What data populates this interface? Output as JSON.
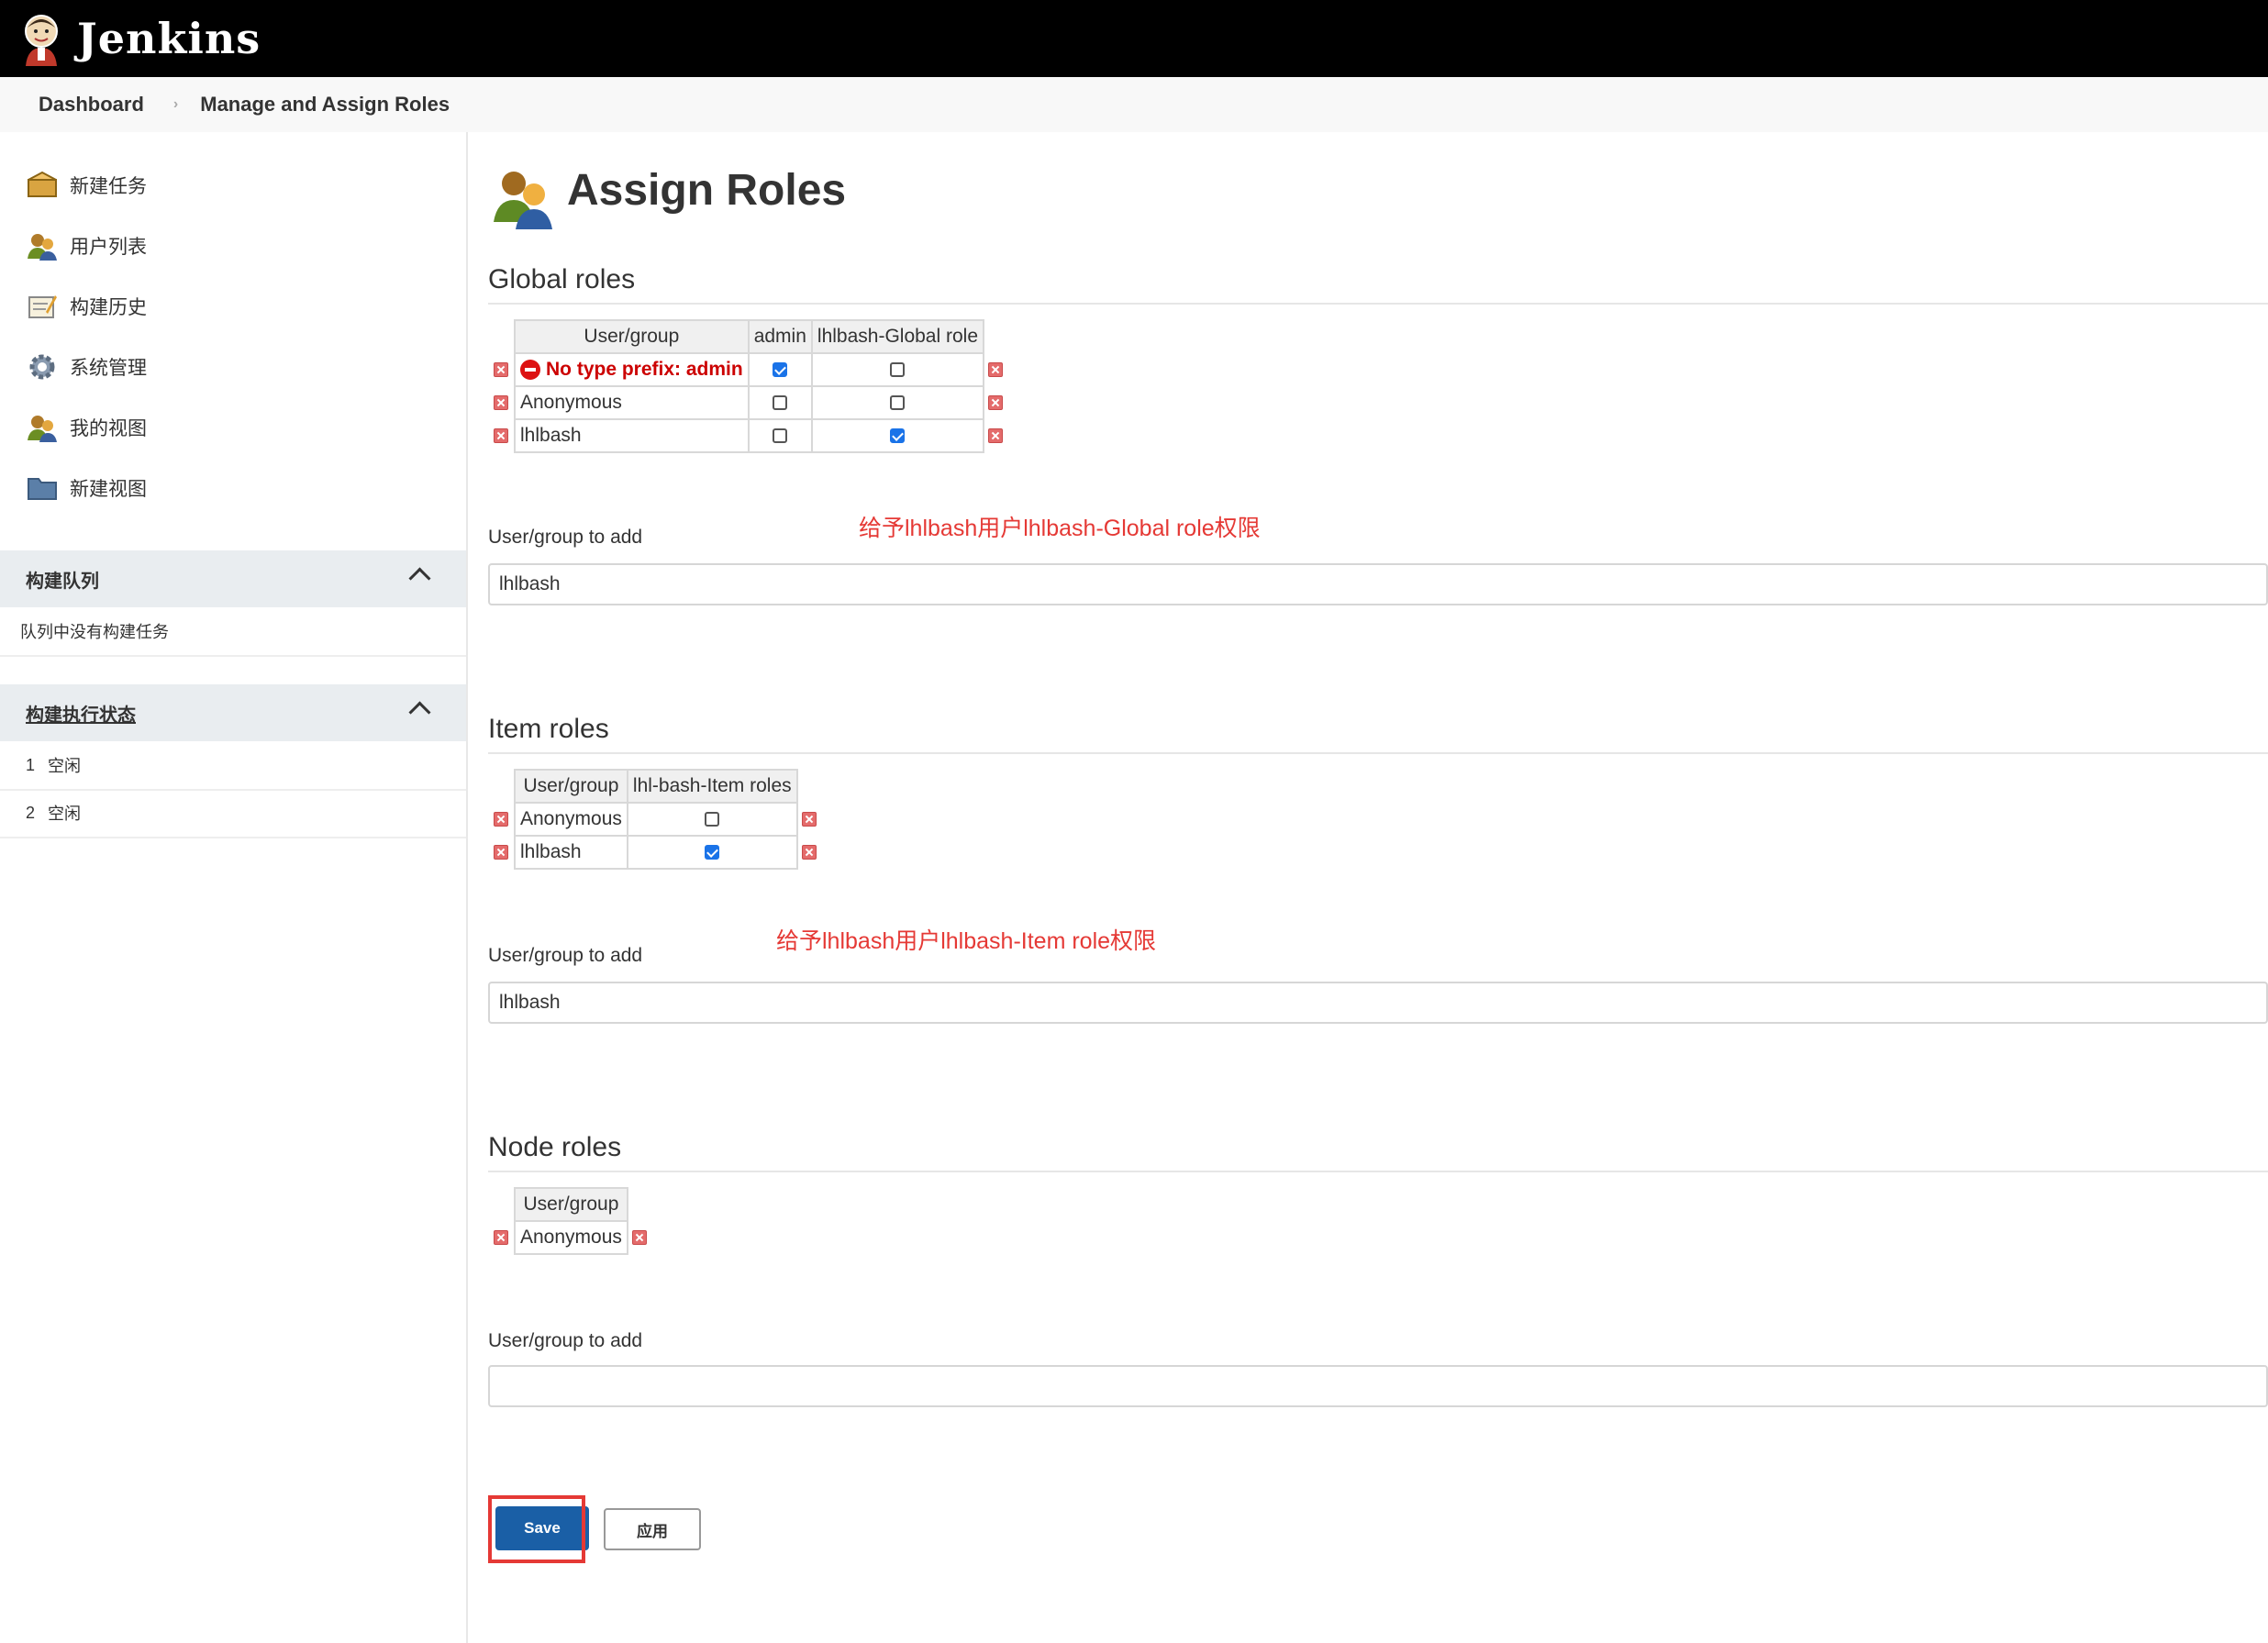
{
  "header": {
    "brand": "Jenkins"
  },
  "breadcrumb": {
    "items": [
      "Dashboard",
      "Manage and Assign Roles"
    ],
    "separator": "›"
  },
  "sidebar": {
    "tasks": [
      {
        "label": "新建任务",
        "icon": "new-item-icon"
      },
      {
        "label": "用户列表",
        "icon": "users-icon"
      },
      {
        "label": "构建历史",
        "icon": "build-history-icon"
      },
      {
        "label": "系统管理",
        "icon": "gear-icon"
      },
      {
        "label": "我的视图",
        "icon": "user-view-icon"
      },
      {
        "label": "新建视图",
        "icon": "folder-icon"
      }
    ],
    "queue": {
      "title": "构建队列",
      "empty_text": "队列中没有构建任务"
    },
    "executors": {
      "title": "构建执行状态",
      "rows": [
        {
          "num": "1",
          "status": "空闲"
        },
        {
          "num": "2",
          "status": "空闲"
        }
      ]
    }
  },
  "main": {
    "title": "Assign Roles",
    "global": {
      "title": "Global roles",
      "headers": [
        "User/group",
        "admin",
        "lhlbash-Global role"
      ],
      "rows": [
        {
          "name": "No type prefix: admin",
          "error": true,
          "checks": [
            true,
            false
          ]
        },
        {
          "name": "Anonymous",
          "error": false,
          "checks": [
            false,
            false
          ]
        },
        {
          "name": "lhlbash",
          "error": false,
          "checks": [
            false,
            true
          ]
        }
      ],
      "add_label": "User/group to add",
      "add_value": "lhlbash",
      "note": "给予lhlbash用户lhlbash-Global role权限"
    },
    "item": {
      "title": "Item roles",
      "headers": [
        "User/group",
        "lhl-bash-Item roles"
      ],
      "rows": [
        {
          "name": "Anonymous",
          "checks": [
            false
          ]
        },
        {
          "name": "lhlbash",
          "checks": [
            true
          ]
        }
      ],
      "add_label": "User/group to add",
      "add_value": "lhlbash",
      "note": "给予lhlbash用户lhlbash-Item role权限"
    },
    "node": {
      "title": "Node roles",
      "headers": [
        "User/group"
      ],
      "rows": [
        {
          "name": "Anonymous"
        }
      ],
      "add_label": "User/group to add",
      "add_value": ""
    },
    "buttons": {
      "save": "Save",
      "apply": "应用"
    },
    "colors": {
      "accent": "#1a5fa6",
      "error": "#cc0000",
      "annotation": "#e53935"
    }
  }
}
